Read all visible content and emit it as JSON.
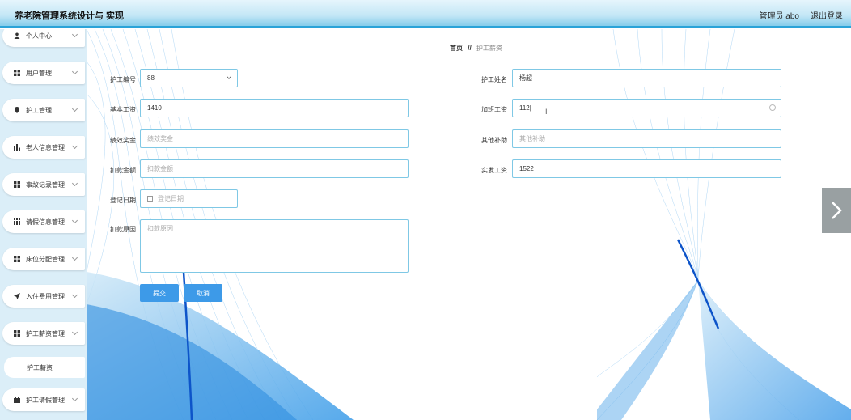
{
  "header": {
    "title": "养老院管理系统设计与 实现",
    "user": "管理员 abo",
    "logout": "退出登录"
  },
  "sidebar": {
    "items": [
      {
        "label": "个人中心",
        "icon": "user-icon"
      },
      {
        "label": "用户管理",
        "icon": "grid-icon"
      },
      {
        "label": "护工管理",
        "icon": "pin-icon"
      },
      {
        "label": "老人信息管理",
        "icon": "bar-chart-icon"
      },
      {
        "label": "事故记录管理",
        "icon": "grid-icon"
      },
      {
        "label": "请假信息管理",
        "icon": "apps-icon"
      },
      {
        "label": "床位分配管理",
        "icon": "grid-icon"
      },
      {
        "label": "入住费用管理",
        "icon": "send-icon"
      },
      {
        "label": "护工薪资管理",
        "icon": "grid-icon"
      },
      {
        "label": "护工请假管理",
        "icon": "briefcase-icon"
      }
    ],
    "sub_item": "护工薪资"
  },
  "breadcrumb": {
    "home": "首页",
    "sep": "//",
    "current": "护工薪资"
  },
  "form": {
    "worker_no": {
      "label": "护工编号",
      "value": "88"
    },
    "worker_name": {
      "label": "护工姓名",
      "value": "杨超"
    },
    "base_salary": {
      "label": "基本工资",
      "value": "1410"
    },
    "overtime_pay": {
      "label": "加班工资",
      "value": "112|"
    },
    "bonus": {
      "label": "绩效奖金",
      "placeholder": "绩效奖金"
    },
    "subsidy": {
      "label": "其他补助",
      "placeholder": "其他补助"
    },
    "deduction": {
      "label": "扣款金额",
      "placeholder": "扣款金额"
    },
    "net_salary": {
      "label": "实发工资",
      "value": "1522"
    },
    "date": {
      "label": "登记日期",
      "placeholder": "登记日期"
    },
    "reason": {
      "label": "扣款原因",
      "placeholder": "扣款原因"
    }
  },
  "buttons": {
    "submit": "提交",
    "cancel": "取消"
  },
  "colors": {
    "accent": "#3d9ae8",
    "header_border": "#2aa3d8",
    "input_border": "#7fc8e5"
  }
}
